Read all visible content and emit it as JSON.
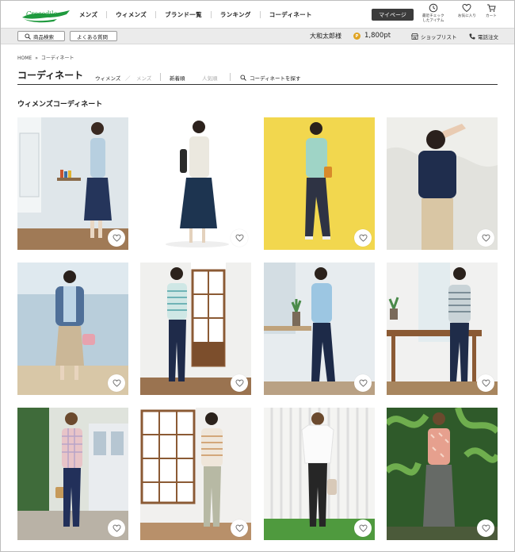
{
  "header": {
    "logo_text": "Crocodile",
    "nav": [
      "メンズ",
      "ウィメンズ",
      "ブランド一覧",
      "ランキング",
      "コーディネート"
    ],
    "mypage_label": "マイページ",
    "recent_label_1": "最近チェック",
    "recent_label_2": "したアイテム",
    "favorite_label": "お気に入り",
    "cart_label": "カート"
  },
  "subbar": {
    "search_label": "商品検索",
    "faq_label": "よくある質問",
    "user_name": "大和太郎様",
    "points": "1,800pt",
    "shoplist_label": "ショップリスト",
    "phone_label": "電話注文"
  },
  "breadcrumb": {
    "home": "HOME",
    "sep": "»",
    "current": "コーディネート"
  },
  "page": {
    "title": "コーディネート",
    "filter_women": "ウィメンズ",
    "filter_sep": "／",
    "filter_men": "メンズ",
    "sort_new": "新着順",
    "sort_popular": "人気順",
    "search_coord": "コーディネートを探す",
    "section_title": "ウィメンズコーディネート"
  },
  "colors": {
    "accent_green": "#1f9a3e",
    "dark_button": "#3b3b3b",
    "coin": "#e0a422",
    "subbar_bg": "#ebebeb"
  }
}
